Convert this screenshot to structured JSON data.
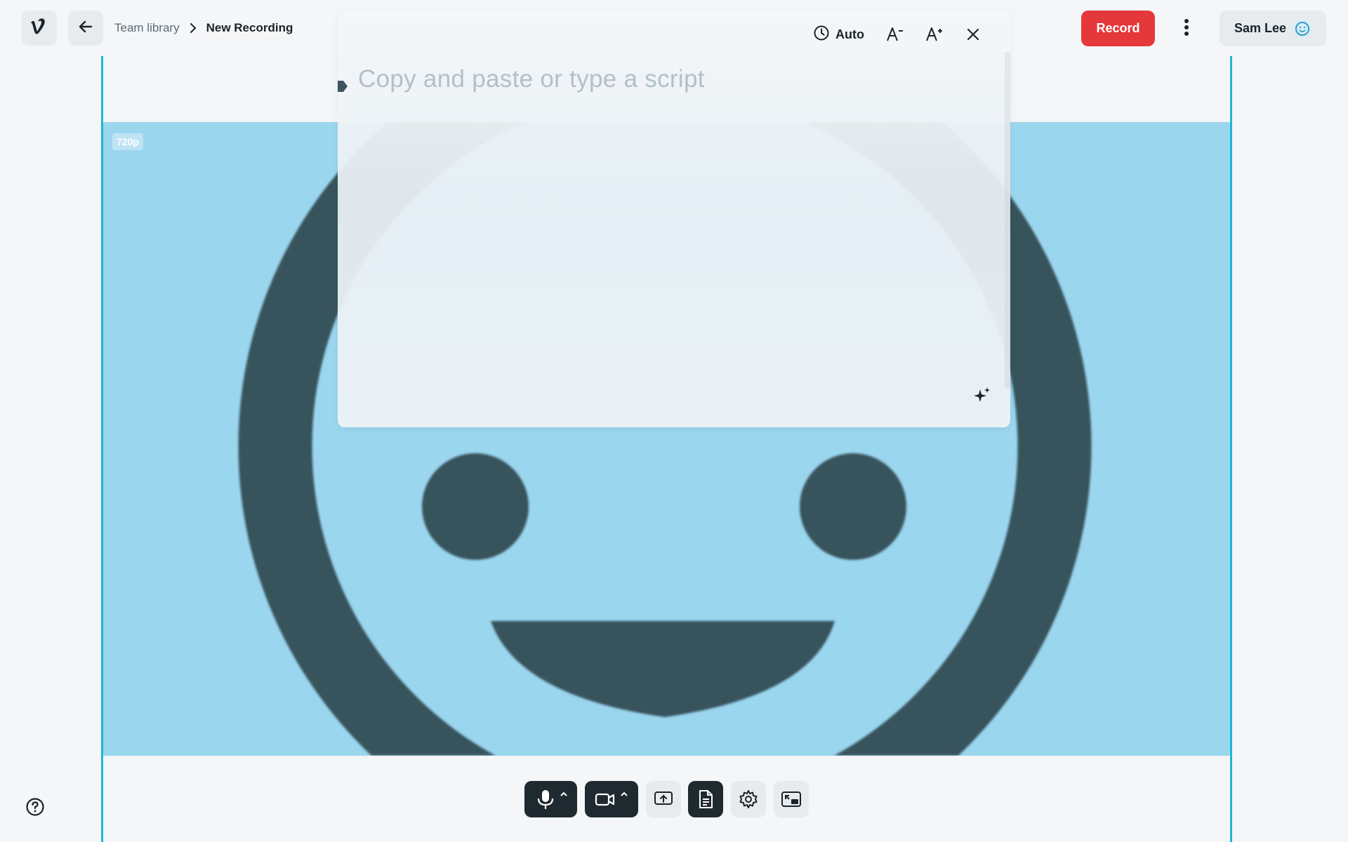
{
  "header": {
    "breadcrumb_parent": "Team library",
    "breadcrumb_current": "New Recording",
    "record_label": "Record",
    "user_name": "Sam Lee"
  },
  "video": {
    "resolution_badge": "720p"
  },
  "script_panel": {
    "speed_label": "Auto",
    "placeholder": "Copy and paste or type a script"
  },
  "colors": {
    "record": "#e5383b",
    "guide": "#1bb7d6",
    "video_bg": "#9bd6ef",
    "face": "#37535c"
  },
  "icons": {
    "logo": "vimeo-logo-icon",
    "back": "arrow-left-icon",
    "breadcrumb_sep": "chevron-right-icon",
    "more": "more-vertical-icon",
    "avatar": "smiley-icon",
    "speed": "clock-icon",
    "font_smaller": "font-decrease-icon",
    "font_larger": "font-increase-icon",
    "close": "close-icon",
    "sparkle": "sparkle-icon",
    "microphone": "microphone-icon",
    "camera": "camera-icon",
    "share_screen": "screen-share-icon",
    "script": "document-icon",
    "settings": "gear-icon",
    "pip": "picture-in-picture-icon",
    "help": "help-icon"
  }
}
